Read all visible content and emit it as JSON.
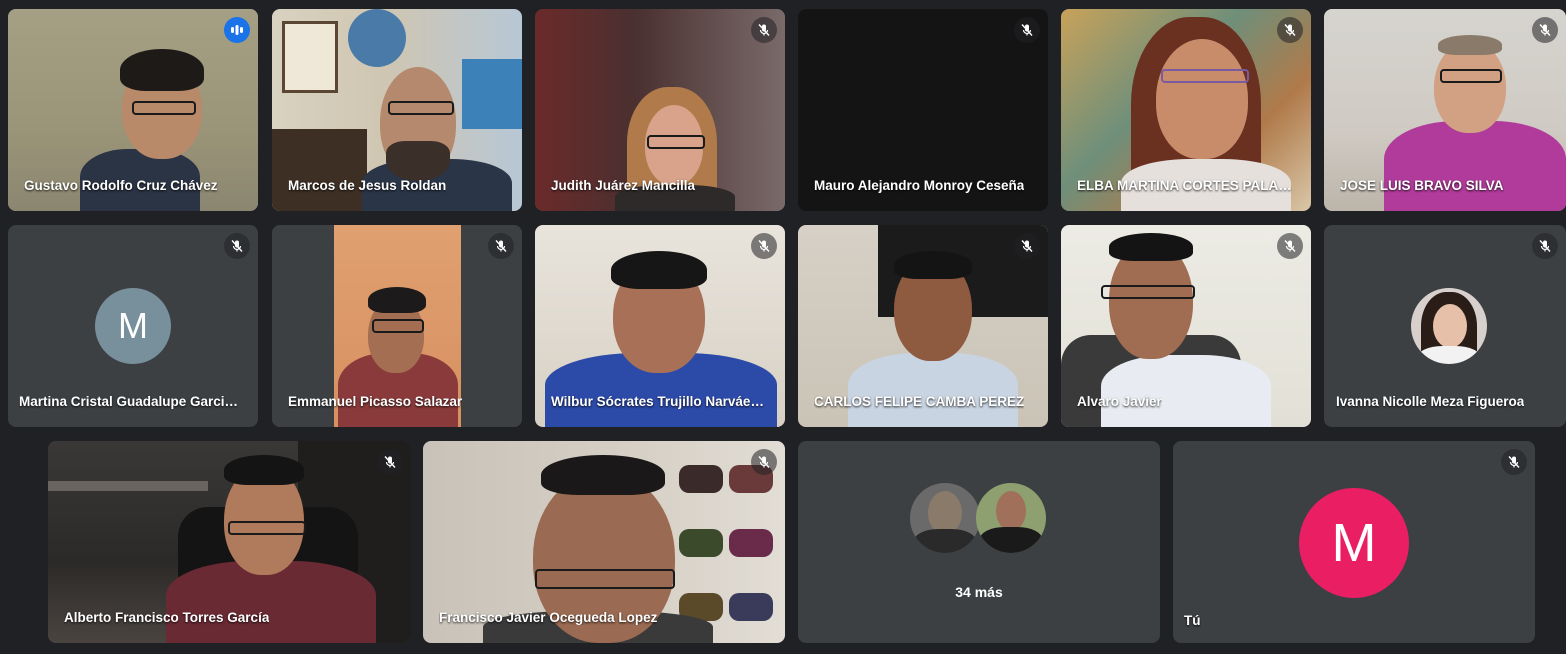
{
  "participants": [
    {
      "name": "Gustavo Rodolfo Cruz Chávez",
      "mic": "speaking-icon"
    },
    {
      "name": "Marcos de Jesus Roldan",
      "mic": "none"
    },
    {
      "name": "Judith Juárez Mancilla",
      "mic": "mic-off-icon"
    },
    {
      "name": "Mauro Alejandro Monroy Ceseña",
      "mic": "mic-off-icon"
    },
    {
      "name": "ELBA MARTINA CORTES PALA…",
      "mic": "mic-off-icon"
    },
    {
      "name": "JOSE LUIS BRAVO SILVA",
      "mic": "mic-off-icon"
    },
    {
      "name": "Martina Cristal Guadalupe Garci…",
      "mic": "mic-off-icon",
      "avatar_letter": "M"
    },
    {
      "name": "Emmanuel Picasso Salazar",
      "mic": "mic-off-icon"
    },
    {
      "name": "Wilbur Sócrates Trujillo Narváe…",
      "mic": "mic-off-icon"
    },
    {
      "name": "CARLOS FELIPE CAMBA PEREZ",
      "mic": "mic-off-icon"
    },
    {
      "name": "Alvaro Javier",
      "mic": "mic-off-icon"
    },
    {
      "name": "Ivanna Nicolle Meza Figueroa",
      "mic": "mic-off-icon"
    },
    {
      "name": "Alberto Francisco Torres García",
      "mic": "mic-off-icon"
    },
    {
      "name": "Francisco Javier Ocegueda Lopez",
      "mic": "mic-off-icon"
    }
  ],
  "more": {
    "label": "34 más"
  },
  "self": {
    "name": "Tú",
    "avatar_letter": "M",
    "mic": "mic-off-icon"
  },
  "colors": {
    "background": "#202124",
    "tile": "#3c4043",
    "speaking_border": "#8ab4f8",
    "speaking_badge": "#1a73e8",
    "avatar_gray": "#78909c",
    "avatar_pink": "#e91e63"
  }
}
